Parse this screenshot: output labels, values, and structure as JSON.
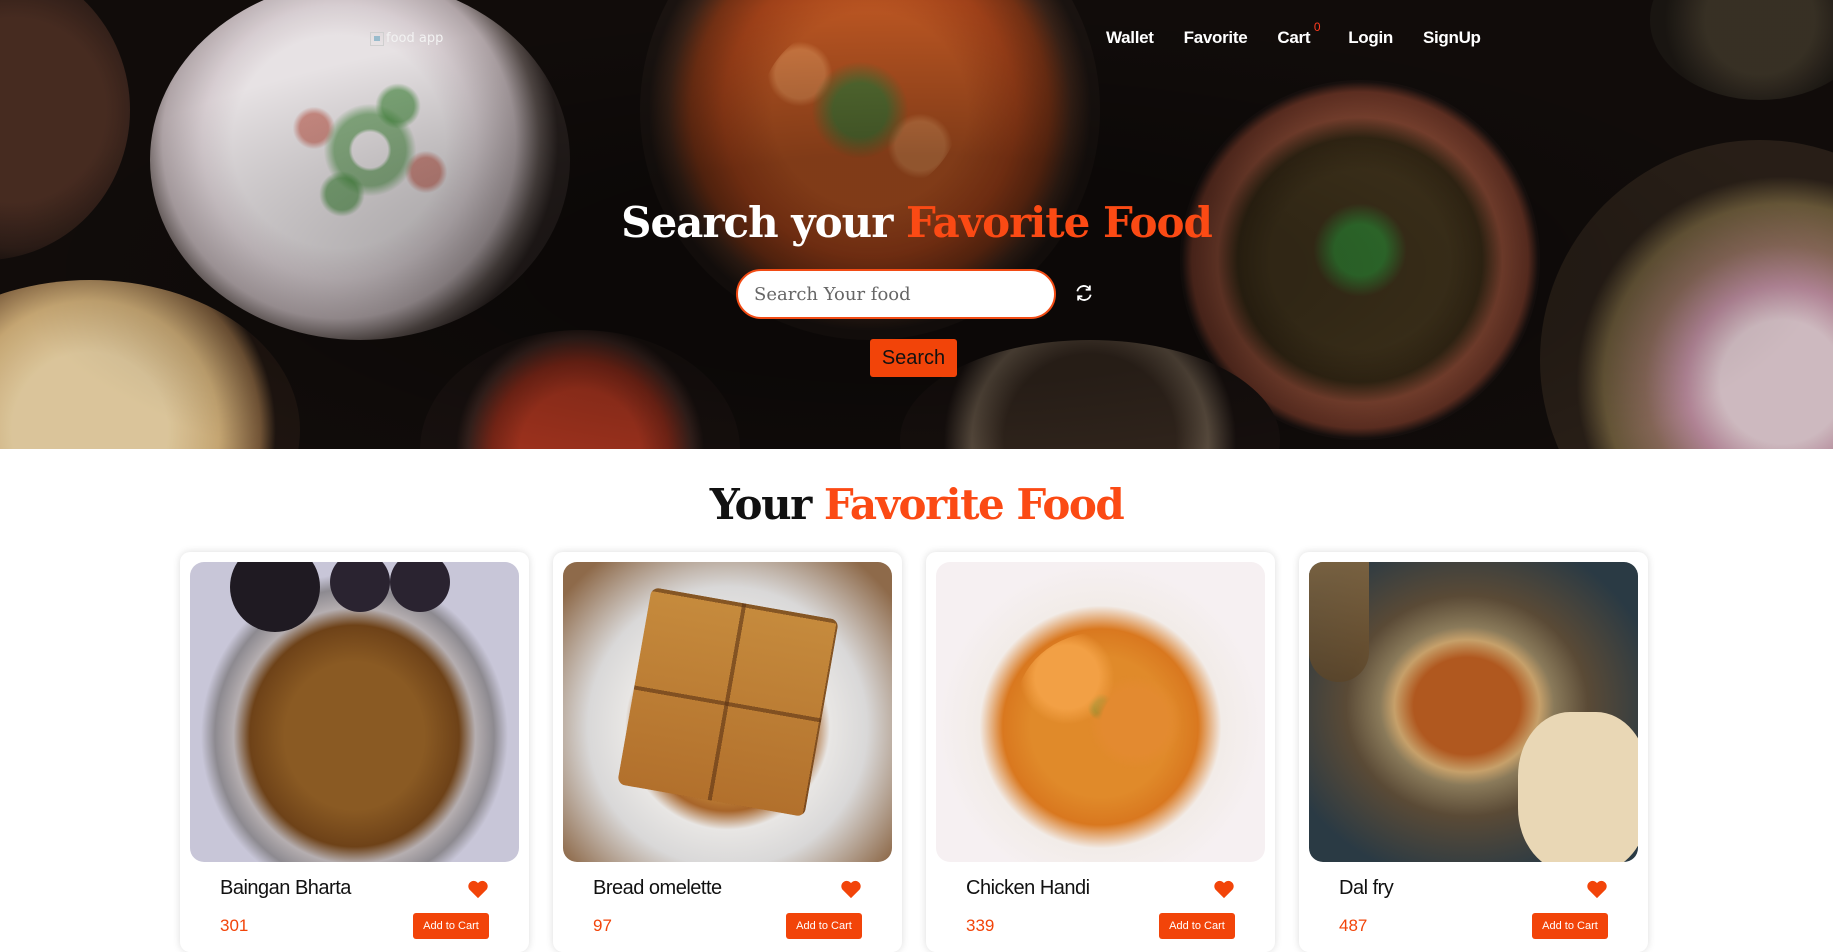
{
  "header": {
    "logo_alt": "food app",
    "nav": {
      "wallet": "Wallet",
      "favorite": "Favorite",
      "cart": "Cart",
      "cart_count": "0",
      "login": "Login",
      "signup": "SignUp"
    }
  },
  "hero": {
    "title_part1": "Search your",
    "title_part2": "Favorite Food",
    "search_placeholder": "Search Your food",
    "search_button": "Search",
    "refresh_icon": "refresh-icon"
  },
  "section": {
    "title_part1": "Your",
    "title_part2": "Favorite Food"
  },
  "cards": [
    {
      "name": "Baingan Bharta",
      "price": "301",
      "button": "Add to Cart",
      "icon": "heart-icon"
    },
    {
      "name": "Bread omelette",
      "price": "97",
      "button": "Add to Cart",
      "icon": "heart-icon"
    },
    {
      "name": "Chicken Handi",
      "price": "339",
      "button": "Add to Cart",
      "icon": "heart-icon"
    },
    {
      "name": "Dal fry",
      "price": "487",
      "button": "Add to Cart",
      "icon": "heart-icon"
    }
  ],
  "colors": {
    "accent": "#f24409",
    "hero_dark": "#120d0b"
  }
}
